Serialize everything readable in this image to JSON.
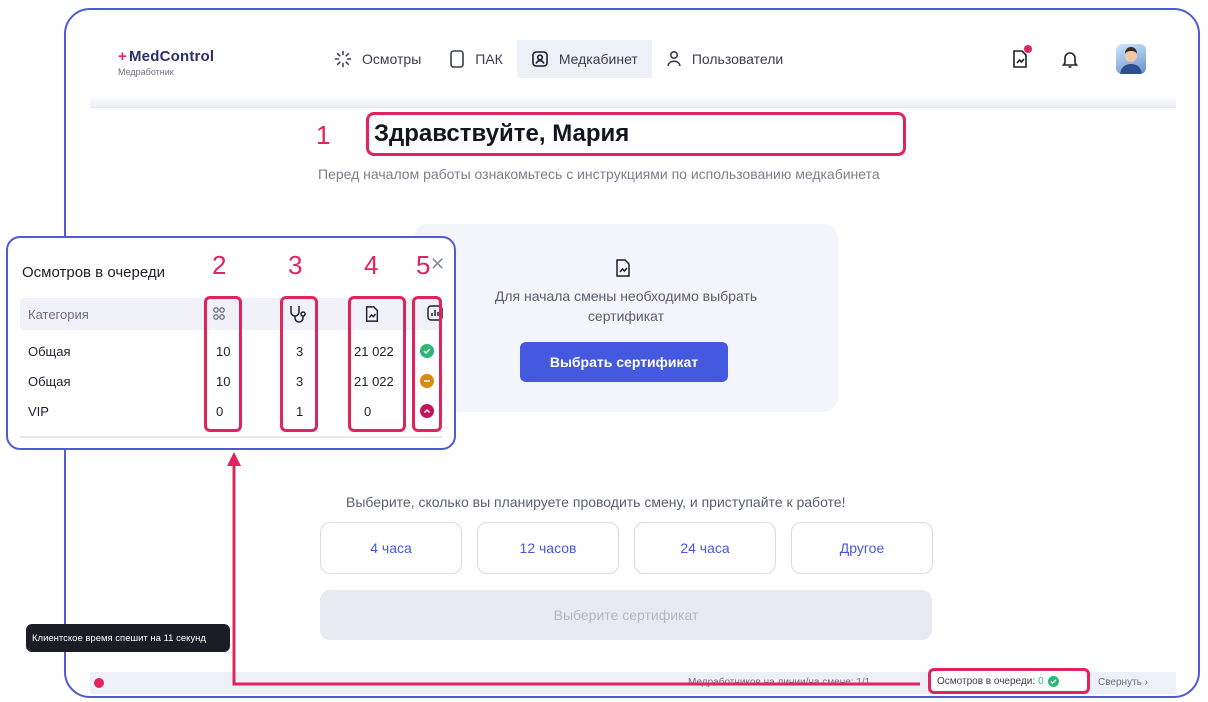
{
  "app": {
    "logo_title": "MedControl",
    "logo_subtitle": "Медработник"
  },
  "nav": {
    "items": [
      {
        "label": "Осмотры",
        "icon": "spinner-icon"
      },
      {
        "label": "ПАК",
        "icon": "device-icon"
      },
      {
        "label": "Медкабинет",
        "icon": "id-card-icon",
        "active": true
      },
      {
        "label": "Пользователи",
        "icon": "user-icon"
      }
    ]
  },
  "header_icons": [
    "document-chart-icon",
    "bell-icon",
    "avatar"
  ],
  "annotations": [
    "1",
    "2",
    "3",
    "4",
    "5"
  ],
  "main": {
    "greeting": "Здравствуйте, Мария",
    "subtitle": "Перед началом работы ознакомьтесь с инструкциями по использованию медкабинета",
    "certificate": {
      "text_line1": "Для начала смены необходимо выбрать",
      "text_line2": "сертификат",
      "button_label": "Выбрать сертификат"
    },
    "shift": {
      "title": "Выберите, сколько вы планируете проводить смену, и приступайте к работе!",
      "options": [
        "4 часа",
        "12 часов",
        "24 часа",
        "Другое"
      ],
      "disabled_button": "Выберите сертификат"
    }
  },
  "tooltip": "Клиентское время спешит на 11 секунд",
  "status_bar": {
    "staff_text": "Медработников на линии/на смене: 1/1",
    "queue_label": "Осмотров в очереди:",
    "queue_value": "0",
    "collapse_label": "Свернуть"
  },
  "queue_popup": {
    "title": "Осмотров в очереди",
    "header": {
      "category": "Категория"
    },
    "rows": [
      {
        "category": "Общая",
        "c2": "10",
        "c3": "3",
        "c4": "21 022",
        "status": "ok"
      },
      {
        "category": "Общая",
        "c2": "10",
        "c3": "3",
        "c4": "21 022",
        "status": "warning"
      },
      {
        "category": "VIP",
        "c2": "0",
        "c3": "1",
        "c4": "0",
        "status": "critical"
      }
    ]
  },
  "colors": {
    "accent": "#4558e0",
    "highlight": "#e0245e",
    "ok": "#2bb673",
    "warning": "#d98a0b",
    "critical": "#c2185b"
  }
}
